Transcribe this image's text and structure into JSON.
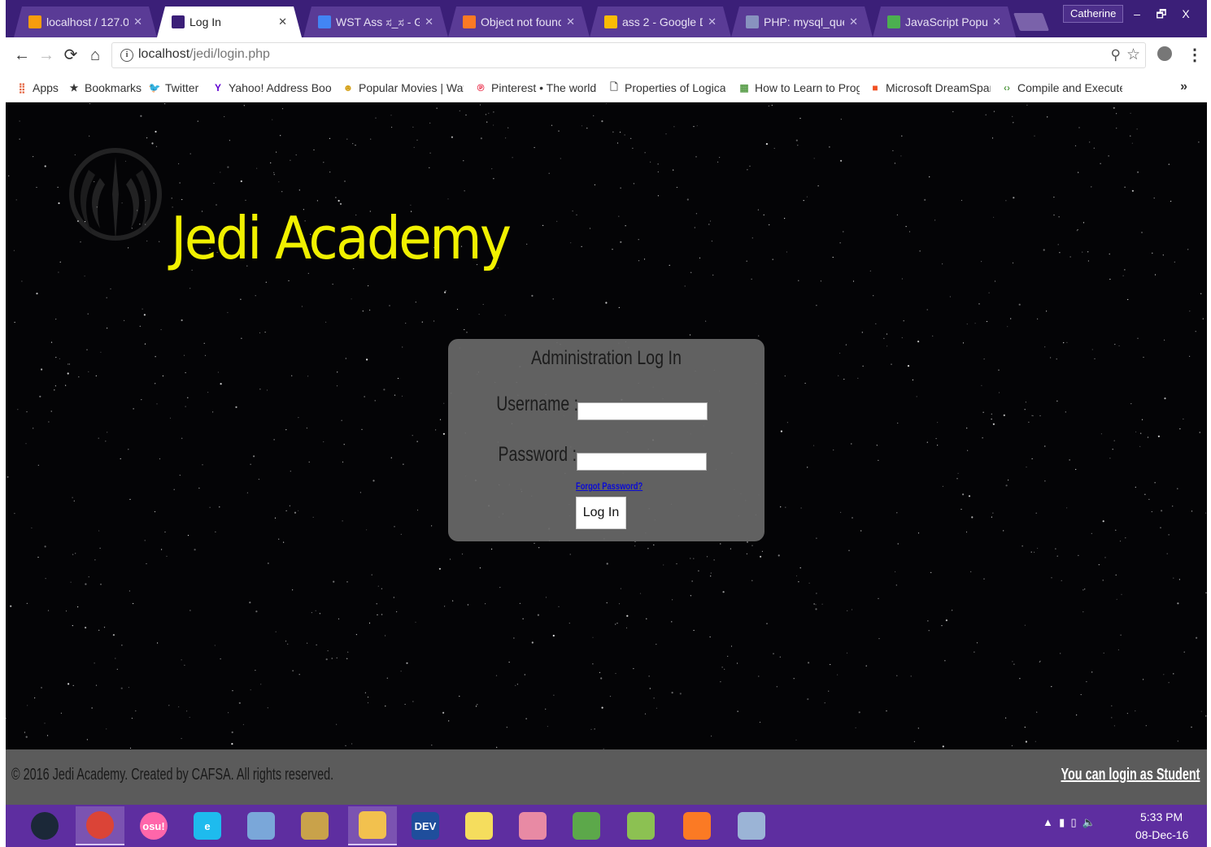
{
  "browser": {
    "tabs": [
      {
        "label": "localhost / 127.0.0",
        "icon": "phpmyadmin-icon",
        "color": "#f89c0e"
      },
      {
        "label": "Log In",
        "icon": "page-icon",
        "color": "#3b1f78",
        "active": true
      },
      {
        "label": "WST Ass ಸ_ಸ - G",
        "icon": "google-docs-icon",
        "color": "#4285f4"
      },
      {
        "label": "Object not found!",
        "icon": "xampp-icon",
        "color": "#fb7a24"
      },
      {
        "label": "ass 2 - Google Driv",
        "icon": "google-drive-icon",
        "color": "#fbbc04"
      },
      {
        "label": "PHP: mysql_query",
        "icon": "php-icon",
        "color": "#8892bf"
      },
      {
        "label": "JavaScript Popup E",
        "icon": "w3schools-icon",
        "color": "#4caf50"
      }
    ],
    "profile_name": "Catherine",
    "window_controls": {
      "minimize": "–",
      "restore": "🗗",
      "close": "X"
    },
    "address": {
      "host": "localhost",
      "path": "/jedi/login.php"
    },
    "bookmarks": [
      {
        "label": "Apps",
        "icon": "apps-grid-icon"
      },
      {
        "label": "Bookmarks",
        "icon": "star-icon"
      },
      {
        "label": "Twitter",
        "icon": "twitter-icon"
      },
      {
        "label": "Yahoo! Address Book",
        "icon": "yahoo-icon"
      },
      {
        "label": "Popular Movies | Wat",
        "icon": "movies-icon"
      },
      {
        "label": "Pinterest • The world",
        "icon": "pinterest-icon"
      },
      {
        "label": "Properties of Logical",
        "icon": "document-icon"
      },
      {
        "label": "How to Learn to Prog",
        "icon": "howto-icon"
      },
      {
        "label": "Microsoft DreamSpar",
        "icon": "microsoft-icon"
      },
      {
        "label": "Compile and Execute",
        "icon": "code-icon"
      }
    ],
    "bookmarks_more": "»"
  },
  "page": {
    "site_title": "Jedi Academy",
    "login": {
      "heading": "Administration Log In",
      "username_label": "Username :",
      "password_label": "Password :",
      "username_value": "",
      "password_value": "",
      "forgot_link": "Forgot Password?",
      "submit_label": "Log In"
    },
    "footer": {
      "copyright": "© 2016 Jedi Academy. Created by CAFSA. All rights reserved.",
      "student_link": "You can login as Student"
    }
  },
  "taskbar": {
    "apps": [
      {
        "name": "steam",
        "icon": "steam-icon",
        "color": "#1b2838"
      },
      {
        "name": "chrome",
        "icon": "chrome-icon",
        "color": "#db4437",
        "active": true
      },
      {
        "name": "osu",
        "icon": "osu-icon",
        "color": "#ff66aa",
        "label": "osu!"
      },
      {
        "name": "internet-explorer",
        "icon": "ie-icon",
        "color": "#1ebbee",
        "label": "e"
      },
      {
        "name": "notepad",
        "icon": "notebook-icon",
        "color": "#7aa7d9"
      },
      {
        "name": "paint",
        "icon": "paint-icon",
        "color": "#c9a24a"
      },
      {
        "name": "file-explorer",
        "icon": "folder-icon",
        "color": "#f2c14e",
        "active": true
      },
      {
        "name": "dev-cpp",
        "icon": "devcpp-icon",
        "color": "#1f4e9c",
        "label": "DEV"
      },
      {
        "name": "sticky-notes",
        "icon": "sticky-icon",
        "color": "#f5dd5d"
      },
      {
        "name": "game",
        "icon": "game-icon",
        "color": "#e88aa4"
      },
      {
        "name": "minecraft",
        "icon": "globe-icon",
        "color": "#5ca84a"
      },
      {
        "name": "notepad-plus",
        "icon": "notepadpp-icon",
        "color": "#8cc152"
      },
      {
        "name": "xampp",
        "icon": "xampp-icon",
        "color": "#fb7a24"
      },
      {
        "name": "display-settings",
        "icon": "monitor-icon",
        "color": "#9bb4d6"
      }
    ],
    "tray": {
      "time": "5:33 PM",
      "date": "08-Dec-16"
    }
  }
}
